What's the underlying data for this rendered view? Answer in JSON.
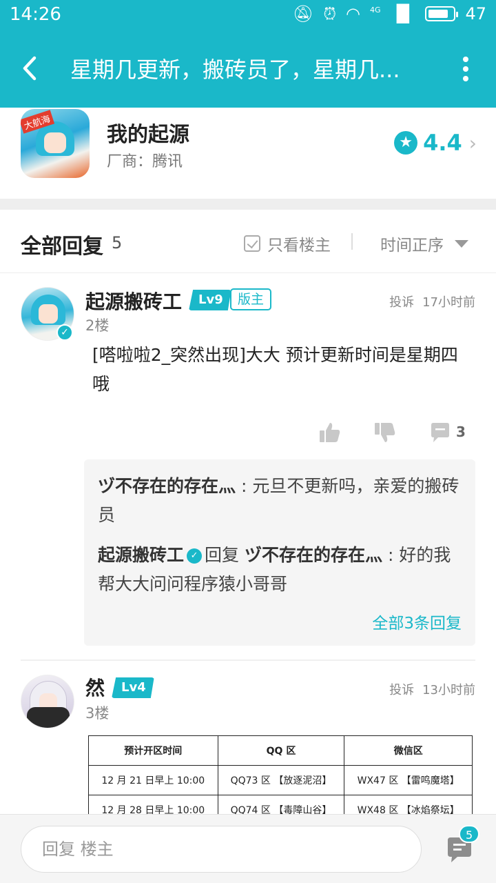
{
  "status_bar": {
    "time": "14:26",
    "network": "4G",
    "battery": "47"
  },
  "header": {
    "title": "星期几更新，搬砖员了，星期几..."
  },
  "game": {
    "name": "我的起源",
    "vendor": "厂商：腾讯",
    "rating": "4.4",
    "icon_tag": "大航海"
  },
  "replies": {
    "title": "全部回复",
    "count": "5",
    "only_op_label": "只看楼主",
    "sort_label": "时间正序"
  },
  "posts": [
    {
      "username": "起源搬砖工",
      "level": "Lv9",
      "role_badge": "版主",
      "floor": "2楼",
      "report_label": "投诉",
      "time": "17小时前",
      "content": "[嗒啦啦2_突然出现]大大  预计更新时间是星期四哦",
      "comment_count": "3",
      "sub_replies": [
        {
          "author": "ヅ不存在的存在灬",
          "text": "元旦不更新吗，亲爱的搬砖员"
        },
        {
          "author": "起源搬砖工",
          "reply_word": "回复",
          "target": "ヅ不存在的存在灬",
          "text": "好的我帮大大问问程序猿小哥哥"
        }
      ],
      "all_replies_label": "全部3条回复"
    },
    {
      "username": "然",
      "level": "Lv4",
      "floor": "3楼",
      "report_label": "投诉",
      "time": "13小时前",
      "table": {
        "headers": [
          "预计开区时间",
          "QQ 区",
          "微信区"
        ],
        "rows": [
          [
            "12 月 21 日早上 10:00",
            "QQ73 区 【放逐泥沼】",
            "WX47 区 【雷鸣魔塔】"
          ],
          [
            "12 月 28 日早上 10:00",
            "QQ74 区 【毒障山谷】",
            "WX48 区 【冰焰祭坛】"
          ]
        ]
      }
    }
  ],
  "bottom_bar": {
    "placeholder": "回复  楼主",
    "badge_count": "5"
  },
  "colors": {
    "accent": "#1ab8c9",
    "background": "#ffffff",
    "separator": "#eeeeee"
  }
}
